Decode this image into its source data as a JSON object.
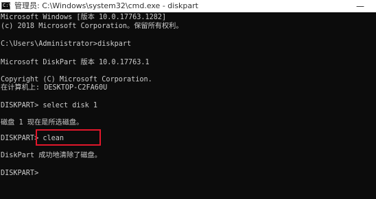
{
  "window": {
    "title": "管理员: C:\\Windows\\system32\\cmd.exe - diskpart",
    "icon": "cmd-icon",
    "minimize_glyph": "—"
  },
  "console": {
    "lines": [
      "Microsoft Windows [版本 10.0.17763.1282]",
      "(c) 2018 Microsoft Corporation。保留所有权利。",
      "",
      "C:\\Users\\Administrator>diskpart",
      "",
      "Microsoft DiskPart 版本 10.0.17763.1",
      "",
      "Copyright (C) Microsoft Corporation.",
      "在计算机上: DESKTOP-C2FA60U",
      "",
      "DISKPART> select disk 1",
      "",
      "磁盘 1 现在是所选磁盘。",
      "",
      "DISKPART> clean",
      "",
      "DiskPart 成功地清除了磁盘。",
      "",
      "DISKPART>"
    ],
    "colors": {
      "background": "#0c0c0c",
      "text": "#cccccc",
      "highlight_box": "#e3172b"
    }
  }
}
